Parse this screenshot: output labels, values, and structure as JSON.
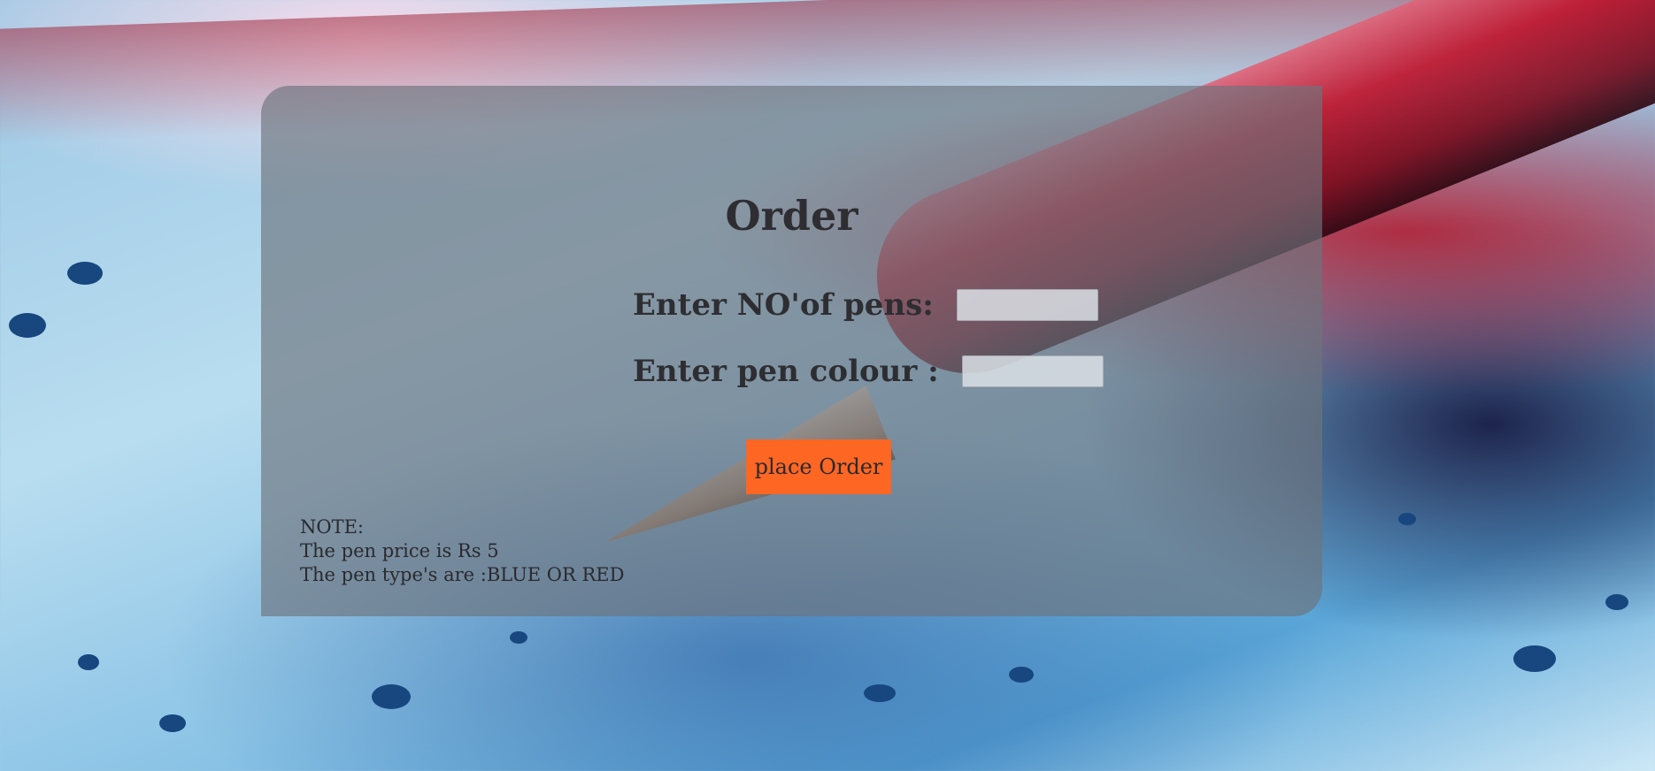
{
  "order_form": {
    "title": "Order",
    "pens_label": "Enter NO'of pens:",
    "pens_value": "",
    "colour_label": "Enter pen colour :",
    "colour_value": "",
    "submit_label": "place Order"
  },
  "note": {
    "heading": "NOTE:",
    "price_line": "The pen price is Rs 5",
    "types_line": "The pen type's are :BLUE OR RED"
  },
  "colors": {
    "card_background": "#6e737d",
    "button_background": "#fe6623",
    "text": "#2e2e32"
  }
}
